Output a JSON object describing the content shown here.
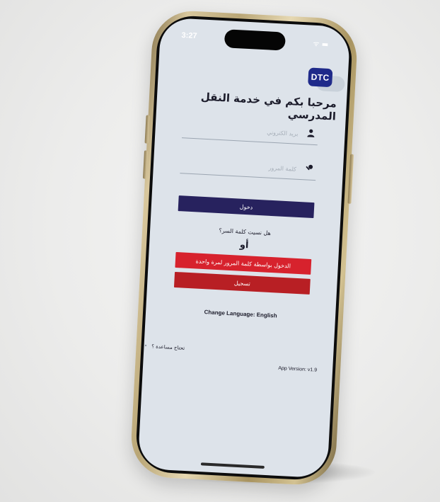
{
  "status_bar": {
    "time": "3:27",
    "icons": "ᯤ ▬"
  },
  "app": {
    "logo_text": "DTC",
    "welcome_title": "مرحبا بكم في خدمة النقل المدرسي",
    "username_placeholder": "بريد الكتروني",
    "password_placeholder": "كلمة المرور",
    "login_button": "دخول",
    "forgot_password": "هل نسيت كلمة السر؟",
    "or_label": "أو",
    "otp_login_button": "الدخول بواسطة كلمة المرور لمرة واحدة",
    "register_button": "تسجيل",
    "change_language": "Change Language: English",
    "help_text": "تحتاج مساعدة ؟",
    "app_version": "App Version: v1.9"
  },
  "colors": {
    "login_button": "#27225e",
    "otp_button": "#d7222d",
    "register_button": "#b81f24",
    "logo_bg": "#1f2a8a",
    "screen_bg": "#dde3ea"
  }
}
